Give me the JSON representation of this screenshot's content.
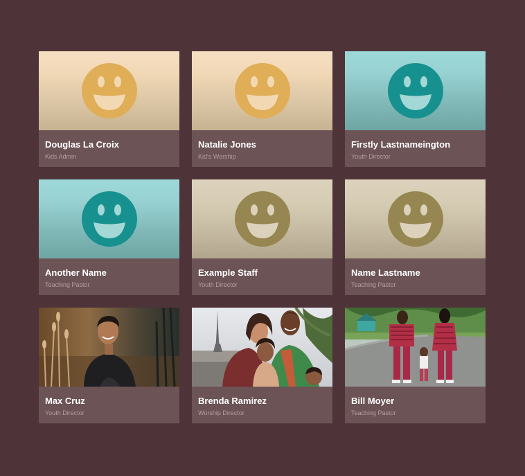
{
  "staff": [
    {
      "name": "Douglas La Croix",
      "role": "Kids Admin",
      "avatar_icon": "smiley-icon",
      "avatar_color": "#dfae57",
      "background": "peach"
    },
    {
      "name": "Natalie Jones",
      "role": "Kid's Worship",
      "avatar_icon": "smiley-icon",
      "avatar_color": "#dfae57",
      "background": "peach"
    },
    {
      "name": "Firstly Lastnameington",
      "role": "Youth Director",
      "avatar_icon": "smiley-icon",
      "avatar_color": "#17918f",
      "background": "teal"
    },
    {
      "name": "Another Name",
      "role": "Teaching Pastor",
      "avatar_icon": "smiley-icon",
      "avatar_color": "#17918f",
      "background": "teal"
    },
    {
      "name": "Example Staff",
      "role": "Youth Director",
      "avatar_icon": "smiley-icon",
      "avatar_color": "#968651",
      "background": "stone"
    },
    {
      "name": "Name Lastname",
      "role": "Teaching Pastor",
      "avatar_icon": "smiley-icon",
      "avatar_color": "#968651",
      "background": "stone"
    },
    {
      "name": "Max Cruz",
      "role": "Youth Director",
      "avatar_icon": "photo",
      "background": "photo"
    },
    {
      "name": "Brenda Ramirez",
      "role": "Worship Director",
      "avatar_icon": "photo",
      "background": "photo"
    },
    {
      "name": "Bill Moyer",
      "role": "Teaching Pastor",
      "avatar_icon": "photo",
      "background": "photo"
    }
  ],
  "colors": {
    "page_background": "#4e3438",
    "card_background": "#6c5355",
    "name_text": "#ffffff",
    "role_text": "#b59fa0"
  }
}
